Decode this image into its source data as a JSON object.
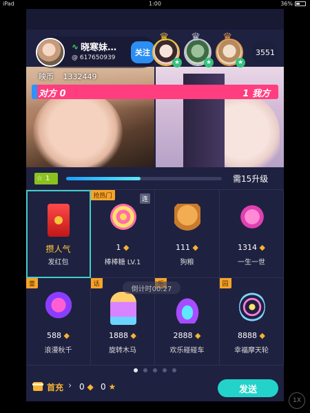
{
  "status_bar": {
    "device": "iPad",
    "time": "1:00",
    "battery": "36%"
  },
  "host": {
    "name": "晓寒妹…",
    "id": "617650939",
    "follow_label": "关注"
  },
  "viewer_count": "3551",
  "coins": {
    "label": "映币",
    "value": "1332449"
  },
  "pk": {
    "left_label": "对方 0",
    "right_label": "1 我方",
    "left_share": 0.02
  },
  "level": {
    "value": "1",
    "need_text": "需15升级",
    "progress": 0.48
  },
  "gifts": [
    {
      "name": "发红包",
      "price": "攒人气",
      "tag": "",
      "corner": "",
      "icon": "red-envelope-icon"
    },
    {
      "name": "棒棒糖 LV.1",
      "price": "1",
      "tag": "抢热门",
      "corner": "连",
      "icon": "lollipop-icon"
    },
    {
      "name": "狗粮",
      "price": "111",
      "tag": "",
      "corner": "",
      "icon": "dog-food-icon"
    },
    {
      "name": "一生一世",
      "price": "1314",
      "tag": "",
      "corner": "",
      "icon": "love-heart-icon"
    },
    {
      "name": "浪漫秋千",
      "price": "588",
      "tag": "童",
      "corner": "",
      "icon": "swing-icon"
    },
    {
      "name": "旋转木马",
      "price": "1888",
      "tag": "话",
      "corner": "",
      "icon": "carousel-icon"
    },
    {
      "name": "欢乐碰碰车",
      "price": "2888",
      "tag": "乐",
      "corner": "",
      "icon": "bumper-car-icon"
    },
    {
      "name": "幸福摩天轮",
      "price": "8888",
      "tag": "园",
      "corner": "",
      "icon": "ferris-wheel-icon"
    }
  ],
  "countdown": "倒计时00:27",
  "pagination": {
    "total": 5,
    "active": 0
  },
  "bottom": {
    "topup_label": "首充",
    "diamonds": "0",
    "stars": "0",
    "send_label": "发送"
  },
  "speed": "1X",
  "colors": {
    "accent": "#23d3c9",
    "follow": "#2c8ef2",
    "pk_red": "#ff3d7f",
    "pk_blue": "#2f90ff",
    "gold": "#f6b333"
  }
}
